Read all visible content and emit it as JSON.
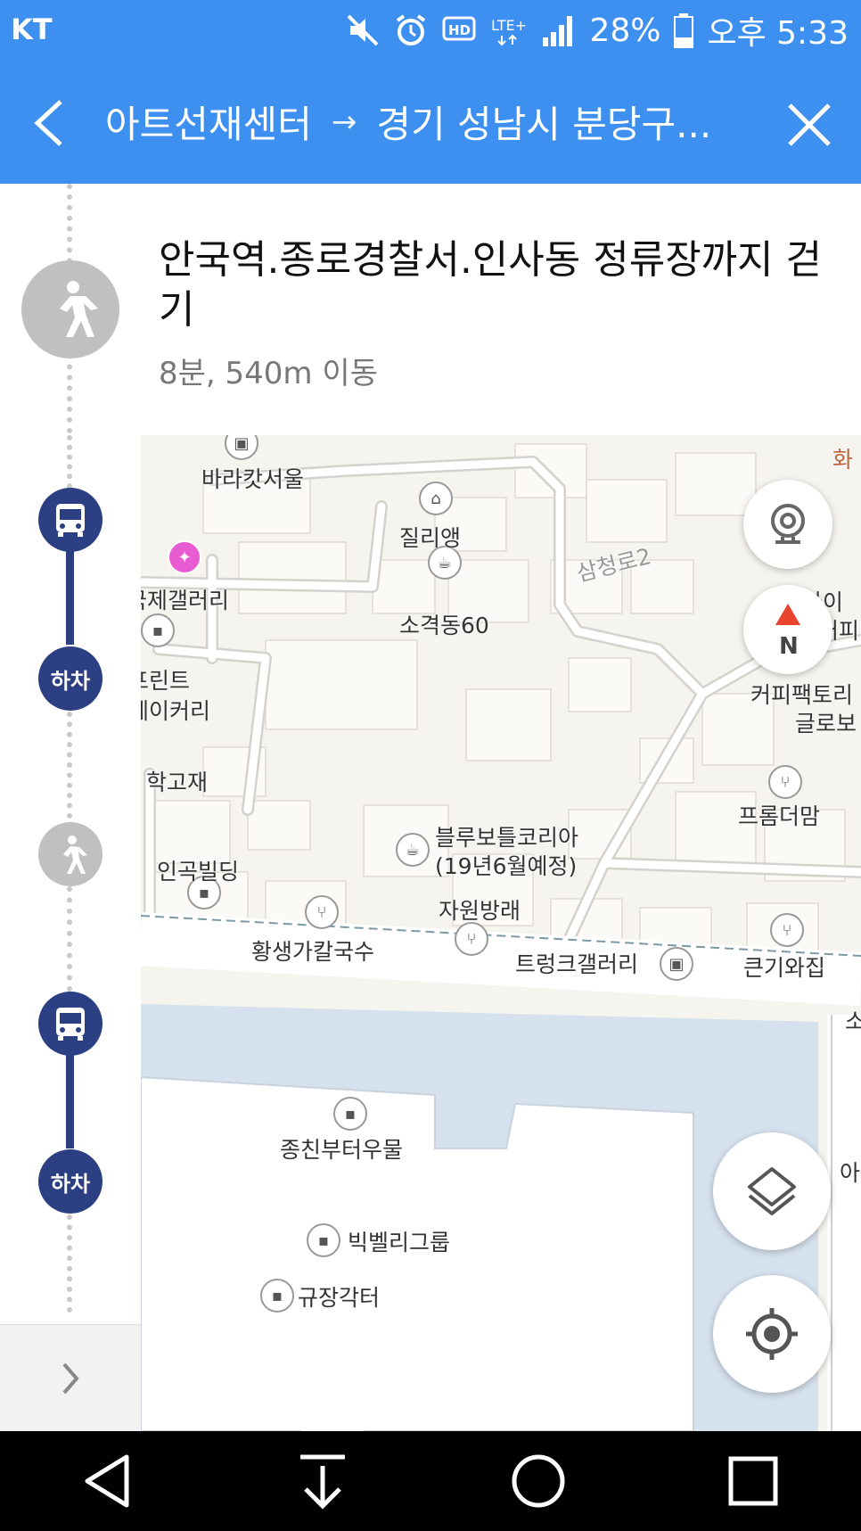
{
  "status_bar": {
    "carrier": "KT",
    "battery": "28%",
    "time": "오후 5:33"
  },
  "header": {
    "origin": "아트선재센터",
    "arrow": "→",
    "destination": "경기 성남시 분당구..."
  },
  "step": {
    "title": "안국역.종로경찰서.인사동 정류장까지 걷기",
    "subtitle": "8분, 540m 이동"
  },
  "timeline": {
    "alight_label_1": "하차",
    "alight_label_2": "하차"
  },
  "map": {
    "labels": {
      "baccarat": "바라캇서울",
      "jilliang": "질리앵",
      "gallery": "국제갤러리",
      "sogyeok": "소격동60",
      "print": "프린트",
      "bakery": "베이커리",
      "hakgojae": "학고재",
      "ingok": "인곡빌딩",
      "bluebottle_1": "블루보틀코리아",
      "bluebottle_2": "(19년6월예정)",
      "jawon": "자원방래",
      "hwangsaengga": "황생가칼국수",
      "trunk": "트렁크갤러리",
      "keungi": "큰기와집",
      "jongchin": "종친부터우물",
      "bigbelly": "빅벨리그룹",
      "gyujang": "규장각터",
      "factory_1": "커피팩토리",
      "factory_2": "글로보",
      "frommthem": "프롬더맘",
      "jeiai_1": "제이와이",
      "jeiai_2": "커피",
      "samcheong": "삼청로2",
      "hwa": "화",
      "so": "소",
      "a": "아"
    }
  }
}
